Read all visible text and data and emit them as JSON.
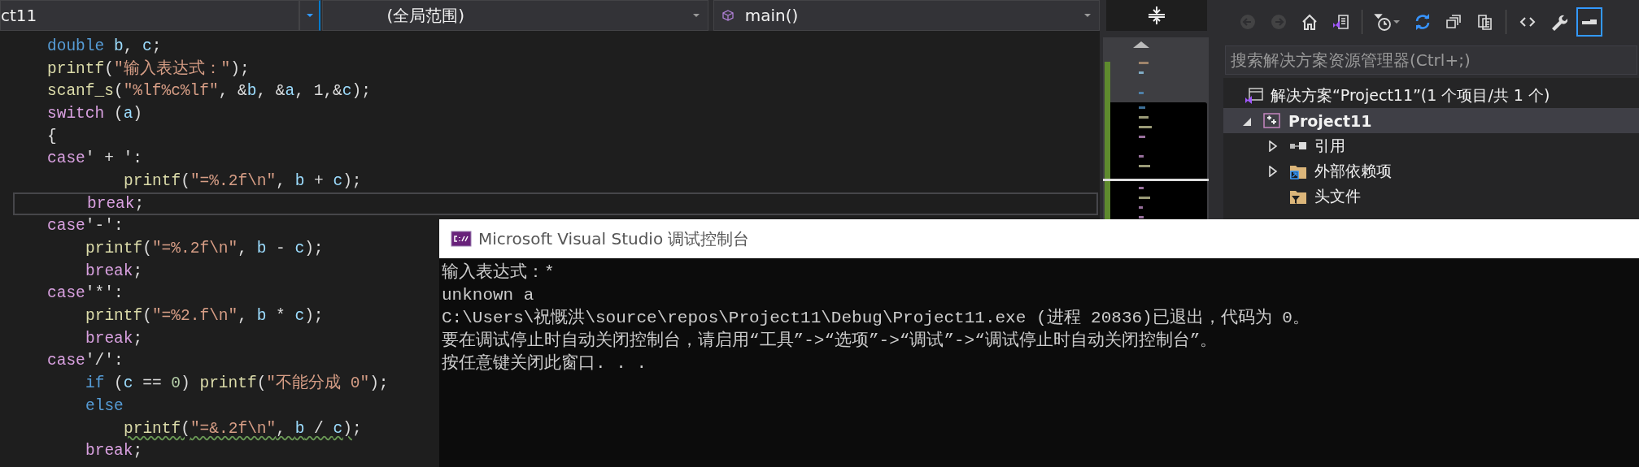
{
  "editor_nav": {
    "project_dropdown": {
      "value": "ct11"
    },
    "scope_dropdown": {
      "value": "(全局范围)"
    },
    "member_dropdown": {
      "value": "main()"
    }
  },
  "code": {
    "lines": [
      {
        "kind": "outer",
        "current": false,
        "tokens": [
          {
            "kind": "keyword",
            "text": "double "
          },
          {
            "kind": "variable",
            "text": "b"
          },
          {
            "kind": "plain",
            "text": ", "
          },
          {
            "kind": "variable",
            "text": "c"
          },
          {
            "kind": "plain",
            "text": ";"
          }
        ]
      },
      {
        "kind": "outer",
        "current": false,
        "tokens": [
          {
            "kind": "function",
            "text": "printf"
          },
          {
            "kind": "plain",
            "text": "("
          },
          {
            "kind": "string",
            "text": "\"输入表达式：\""
          },
          {
            "kind": "plain",
            "text": ");"
          }
        ]
      },
      {
        "kind": "outer",
        "current": false,
        "tokens": [
          {
            "kind": "function",
            "text": "scanf_s"
          },
          {
            "kind": "plain",
            "text": "("
          },
          {
            "kind": "string",
            "text": "\"%lf%c%lf\""
          },
          {
            "kind": "plain",
            "text": ", &"
          },
          {
            "kind": "variable",
            "text": "b"
          },
          {
            "kind": "plain",
            "text": ", &"
          },
          {
            "kind": "variable",
            "text": "a"
          },
          {
            "kind": "plain",
            "text": ", 1,&"
          },
          {
            "kind": "variable",
            "text": "c"
          },
          {
            "kind": "plain",
            "text": ");"
          }
        ]
      },
      {
        "kind": "outer",
        "current": false,
        "tokens": [
          {
            "kind": "control",
            "text": "switch"
          },
          {
            "kind": "plain",
            "text": " ("
          },
          {
            "kind": "variable",
            "text": "a"
          },
          {
            "kind": "plain",
            "text": ")"
          }
        ]
      },
      {
        "kind": "outer",
        "current": false,
        "tokens": [
          {
            "kind": "plain",
            "text": "{"
          }
        ]
      },
      {
        "kind": "outer",
        "current": false,
        "tokens": [
          {
            "kind": "control",
            "text": "case"
          },
          {
            "kind": "plain",
            "text": "' + ':"
          }
        ]
      },
      {
        "kind": "deep",
        "current": false,
        "tokens": [
          {
            "kind": "function",
            "text": "printf"
          },
          {
            "kind": "plain",
            "text": "("
          },
          {
            "kind": "string",
            "text": "\"=%.2f\\n\""
          },
          {
            "kind": "plain",
            "text": ", "
          },
          {
            "kind": "variable",
            "text": "b"
          },
          {
            "kind": "plain",
            "text": " + "
          },
          {
            "kind": "variable",
            "text": "c"
          },
          {
            "kind": "plain",
            "text": ");"
          }
        ]
      },
      {
        "kind": "inner",
        "current": true,
        "tokens": [
          {
            "kind": "control",
            "text": "break"
          },
          {
            "kind": "plain",
            "text": ";"
          }
        ]
      },
      {
        "kind": "outer",
        "current": false,
        "tokens": [
          {
            "kind": "control",
            "text": "case"
          },
          {
            "kind": "plain",
            "text": "'-':"
          }
        ]
      },
      {
        "kind": "inner",
        "current": false,
        "tokens": [
          {
            "kind": "function",
            "text": "printf"
          },
          {
            "kind": "plain",
            "text": "("
          },
          {
            "kind": "string",
            "text": "\"=%.2f\\n\""
          },
          {
            "kind": "plain",
            "text": ", "
          },
          {
            "kind": "variable",
            "text": "b"
          },
          {
            "kind": "plain",
            "text": " - "
          },
          {
            "kind": "variable",
            "text": "c"
          },
          {
            "kind": "plain",
            "text": ");"
          }
        ]
      },
      {
        "kind": "inner",
        "current": false,
        "tokens": [
          {
            "kind": "control",
            "text": "break"
          },
          {
            "kind": "plain",
            "text": ";"
          }
        ]
      },
      {
        "kind": "outer",
        "current": false,
        "tokens": [
          {
            "kind": "control",
            "text": "case"
          },
          {
            "kind": "plain",
            "text": "'*':"
          }
        ]
      },
      {
        "kind": "inner",
        "current": false,
        "tokens": [
          {
            "kind": "function",
            "text": "printf"
          },
          {
            "kind": "plain",
            "text": "("
          },
          {
            "kind": "string",
            "text": "\"=%2.f\\n\""
          },
          {
            "kind": "plain",
            "text": ", "
          },
          {
            "kind": "variable",
            "text": "b"
          },
          {
            "kind": "plain",
            "text": " * "
          },
          {
            "kind": "variable",
            "text": "c"
          },
          {
            "kind": "plain",
            "text": ");"
          }
        ]
      },
      {
        "kind": "inner",
        "current": false,
        "tokens": [
          {
            "kind": "control",
            "text": "break"
          },
          {
            "kind": "plain",
            "text": ";"
          }
        ]
      },
      {
        "kind": "outer",
        "current": false,
        "tokens": [
          {
            "kind": "control",
            "text": "case"
          },
          {
            "kind": "plain",
            "text": "'/':"
          }
        ]
      },
      {
        "kind": "inner",
        "current": false,
        "tokens": [
          {
            "kind": "keyword",
            "text": "if"
          },
          {
            "kind": "plain",
            "text": " ("
          },
          {
            "kind": "variable",
            "text": "c"
          },
          {
            "kind": "plain",
            "text": " == "
          },
          {
            "kind": "number",
            "text": "0"
          },
          {
            "kind": "plain",
            "text": ") "
          },
          {
            "kind": "function",
            "text": "printf"
          },
          {
            "kind": "plain",
            "text": "("
          },
          {
            "kind": "string",
            "text": "\"不能分成 0\""
          },
          {
            "kind": "plain",
            "text": ");"
          }
        ]
      },
      {
        "kind": "inner",
        "current": false,
        "tokens": [
          {
            "kind": "keyword",
            "text": "else"
          }
        ]
      },
      {
        "kind": "deep",
        "current": false,
        "tokens": [
          {
            "kind": "function",
            "text": "printf",
            "squiggle": true
          },
          {
            "kind": "plain",
            "text": "(",
            "squiggle": true
          },
          {
            "kind": "string",
            "text": "\"=&.2f\\n\"",
            "squiggle": true
          },
          {
            "kind": "plain",
            "text": ", ",
            "squiggle": true
          },
          {
            "kind": "variable",
            "text": "b",
            "squiggle": true
          },
          {
            "kind": "plain",
            "text": " / ",
            "squiggle": true
          },
          {
            "kind": "variable",
            "text": "c",
            "squiggle": true
          },
          {
            "kind": "plain",
            "text": ")",
            "squiggle": true
          },
          {
            "kind": "plain",
            "text": ";"
          }
        ]
      },
      {
        "kind": "inner",
        "current": false,
        "tokens": [
          {
            "kind": "control",
            "text": "break"
          },
          {
            "kind": "plain",
            "text": ";"
          }
        ]
      }
    ]
  },
  "solution_explorer": {
    "toolbar": [
      [
        {
          "kind": "back",
          "disabled": true,
          "selected": false
        },
        {
          "kind": "forward",
          "disabled": true,
          "selected": false
        },
        {
          "kind": "home",
          "disabled": false,
          "selected": false
        },
        {
          "kind": "switch_views",
          "disabled": false,
          "selected": false
        }
      ],
      [
        {
          "kind": "history",
          "disabled": false,
          "selected": false
        },
        {
          "kind": "sync",
          "disabled": false,
          "selected": false
        },
        {
          "kind": "collapse",
          "disabled": false,
          "selected": false
        },
        {
          "kind": "documents",
          "disabled": false,
          "selected": false
        }
      ],
      [
        {
          "kind": "code",
          "disabled": false,
          "selected": false
        },
        {
          "kind": "wrench",
          "disabled": false,
          "selected": false
        },
        {
          "kind": "preview",
          "disabled": false,
          "selected": true
        }
      ]
    ],
    "search": {
      "placeholder": "搜索解决方案资源管理器(Ctrl+;)"
    },
    "tree": [
      {
        "kind": "solution",
        "label": "解决方案“Project11”(1 个项目/共 1 个)",
        "selected": false,
        "children": [
          {
            "kind": "project",
            "label": "Project11",
            "expanded": true,
            "selected": true,
            "children": [
              {
                "kind": "references",
                "label": "引用",
                "expanded": false,
                "selected": false
              },
              {
                "kind": "external",
                "label": "外部依赖项",
                "expanded": false,
                "selected": false
              },
              {
                "kind": "headers",
                "label": "头文件",
                "selected": false
              }
            ]
          }
        ]
      }
    ]
  },
  "console": {
    "title": "Microsoft Visual Studio 调试控制台",
    "lines": [
      "输入表达式：*",
      "unknown a",
      "C:\\Users\\祝慨洪\\source\\repos\\Project11\\Debug\\Project11.exe (进程 20836)已退出，代码为 0。",
      "要在调试停止时自动关闭控制台，请启用“工具”->“选项”->“调试”->“调试停止时自动关闭控制台”。",
      "按任意键关闭此窗口. . ."
    ]
  }
}
